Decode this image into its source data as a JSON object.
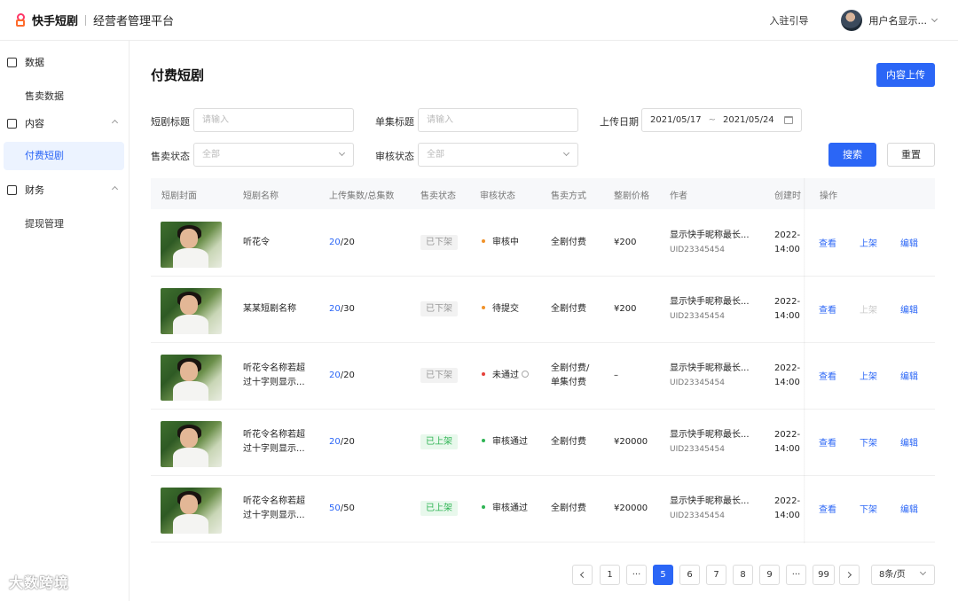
{
  "header": {
    "brand": "快手短剧",
    "platform": "经营者管理平台",
    "guide": "入驻引导",
    "username": "用户名显示..."
  },
  "sidebar": {
    "groups": [
      {
        "label": "数据",
        "icon": "chart-icon",
        "items": [
          "售卖数据"
        ]
      },
      {
        "label": "内容",
        "icon": "video-icon",
        "items": [
          "付费短剧"
        ]
      },
      {
        "label": "财务",
        "icon": "wallet-icon",
        "items": [
          "提现管理"
        ]
      }
    ],
    "active_item": "付费短剧"
  },
  "page": {
    "title": "付费短剧",
    "upload_button": "内容上传"
  },
  "filters": {
    "series_title_label": "短剧标题",
    "series_title_placeholder": "请输入",
    "episode_title_label": "单集标题",
    "episode_title_placeholder": "请输入",
    "upload_date_label": "上传日期",
    "date_start": "2021/05/17",
    "date_sep": "~",
    "date_end": "2021/05/24",
    "sale_status_label": "售卖状态",
    "sale_status_value": "全部",
    "review_status_label": "审核状态",
    "review_status_value": "全部",
    "search_button": "搜索",
    "reset_button": "重置"
  },
  "table": {
    "columns": [
      "短剧封面",
      "短剧名称",
      "上传集数/总集数",
      "售卖状态",
      "审核状态",
      "售卖方式",
      "整剧价格",
      "作者",
      "创建时",
      "操作"
    ],
    "rows": [
      {
        "name": [
          "听花令"
        ],
        "uploaded": "20",
        "total": "/20",
        "sale": "已下架",
        "sale_on": false,
        "review": "审核中",
        "review_color": "#f0922a",
        "review_info": false,
        "method": [
          "全剧付费"
        ],
        "price": "¥200",
        "author": "显示快手昵称最长...",
        "uid": "UID23345454",
        "created": [
          "2022-",
          "14:00"
        ],
        "ops": [
          "查看",
          "上架",
          "编辑"
        ],
        "op2_disabled": false
      },
      {
        "name": [
          "某某短剧名称"
        ],
        "uploaded": "20",
        "total": "/30",
        "sale": "已下架",
        "sale_on": false,
        "review": "待提交",
        "review_color": "#f0922a",
        "review_info": false,
        "method": [
          "全剧付费"
        ],
        "price": "¥200",
        "author": "显示快手昵称最长...",
        "uid": "UID23345454",
        "created": [
          "2022-",
          "14:00"
        ],
        "ops": [
          "查看",
          "上架",
          "编辑"
        ],
        "op2_disabled": true
      },
      {
        "name": [
          "听花令名称若超",
          "过十字则显示..."
        ],
        "uploaded": "20",
        "total": "/20",
        "sale": "已下架",
        "sale_on": false,
        "review": "未通过",
        "review_color": "#e5413a",
        "review_info": true,
        "method": [
          "全剧付费/",
          "单集付费"
        ],
        "price": "–",
        "author": "显示快手昵称最长...",
        "uid": "UID23345454",
        "created": [
          "2022-",
          "14:00"
        ],
        "ops": [
          "查看",
          "上架",
          "编辑"
        ],
        "op2_disabled": false
      },
      {
        "name": [
          "听花令名称若超",
          "过十字则显示..."
        ],
        "uploaded": "20",
        "total": "/20",
        "sale": "已上架",
        "sale_on": true,
        "review": "审核通过",
        "review_color": "#2fb454",
        "review_info": false,
        "method": [
          "全剧付费"
        ],
        "price": "¥20000",
        "author": "显示快手昵称最长...",
        "uid": "UID23345454",
        "created": [
          "2022-",
          "14:00"
        ],
        "ops": [
          "查看",
          "下架",
          "编辑"
        ],
        "op2_disabled": false
      },
      {
        "name": [
          "听花令名称若超",
          "过十字则显示..."
        ],
        "uploaded": "50",
        "total": "/50",
        "sale": "已上架",
        "sale_on": true,
        "review": "审核通过",
        "review_color": "#2fb454",
        "review_info": false,
        "method": [
          "全剧付费"
        ],
        "price": "¥20000",
        "author": "显示快手昵称最长...",
        "uid": "UID23345454",
        "created": [
          "2022-",
          "14:00"
        ],
        "ops": [
          "查看",
          "下架",
          "编辑"
        ],
        "op2_disabled": false
      }
    ]
  },
  "pagination": {
    "pages": [
      "1",
      "···",
      "5",
      "6",
      "7",
      "8",
      "9",
      "···",
      "99"
    ],
    "current": "5",
    "page_size": "8条/页"
  },
  "watermark": "大数跨境"
}
